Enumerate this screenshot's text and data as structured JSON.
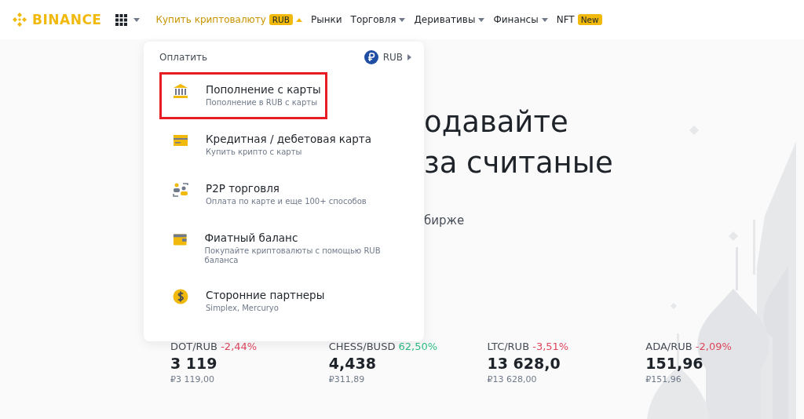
{
  "nav": {
    "logo": "BINANCE",
    "items": [
      {
        "label": "Купить криптовалюту",
        "badge": "RUB",
        "kind": "dropdown",
        "selected": true
      },
      {
        "label": "Рынки",
        "kind": "link",
        "selected": false
      },
      {
        "label": "Торговля",
        "kind": "dropdown",
        "selected": false
      },
      {
        "label": "Деривативы",
        "kind": "dropdown",
        "selected": false
      },
      {
        "label": "Финансы",
        "kind": "dropdown",
        "selected": false
      },
      {
        "label": "NFT",
        "badge": "New",
        "kind": "link",
        "selected": false
      }
    ]
  },
  "dropdown": {
    "header": "Оплатить",
    "currency": "RUB",
    "items": [
      {
        "kind": "bank",
        "title": "Пополнение с карты",
        "subtitle": "Пополнение в RUB с карты",
        "highlighted": true
      },
      {
        "kind": "card",
        "title": "Кредитная / дебетовая карта",
        "subtitle": "Купить крипто с карты",
        "highlighted": false
      },
      {
        "kind": "p2p",
        "title": "P2P торговля",
        "subtitle": "Оплата по карте и еще 100+ способов",
        "highlighted": false
      },
      {
        "kind": "wallet",
        "title": "Фиатный баланс",
        "subtitle": "Покупайте криптовалюты с помощью RUB баланса",
        "highlighted": false
      },
      {
        "kind": "dollar",
        "title": "Сторонние партнеры",
        "subtitle": "Simplex, Mercuryo",
        "highlighted": false
      }
    ]
  },
  "hero": {
    "heading_lines": [
      "одавайте",
      "за считаные"
    ],
    "subtitle": "бирже"
  },
  "tickers": [
    {
      "pair": "DOT/RUB",
      "change": "-2,44%",
      "color": "#e0465e",
      "price": "3 119",
      "fiat": "₽3 119,00"
    },
    {
      "pair": "CHESS/BUSD",
      "change": "62,50%",
      "color": "#2ebd85",
      "price": "4,438",
      "fiat": "₽311,89"
    },
    {
      "pair": "LTC/RUB",
      "change": "-3,51%",
      "color": "#e0465e",
      "price": "13 628,0",
      "fiat": "₽13 628,00"
    },
    {
      "pair": "ADA/RUB",
      "change": "-2,09%",
      "color": "#e0465e",
      "price": "151,96",
      "fiat": "₽151,96"
    }
  ]
}
